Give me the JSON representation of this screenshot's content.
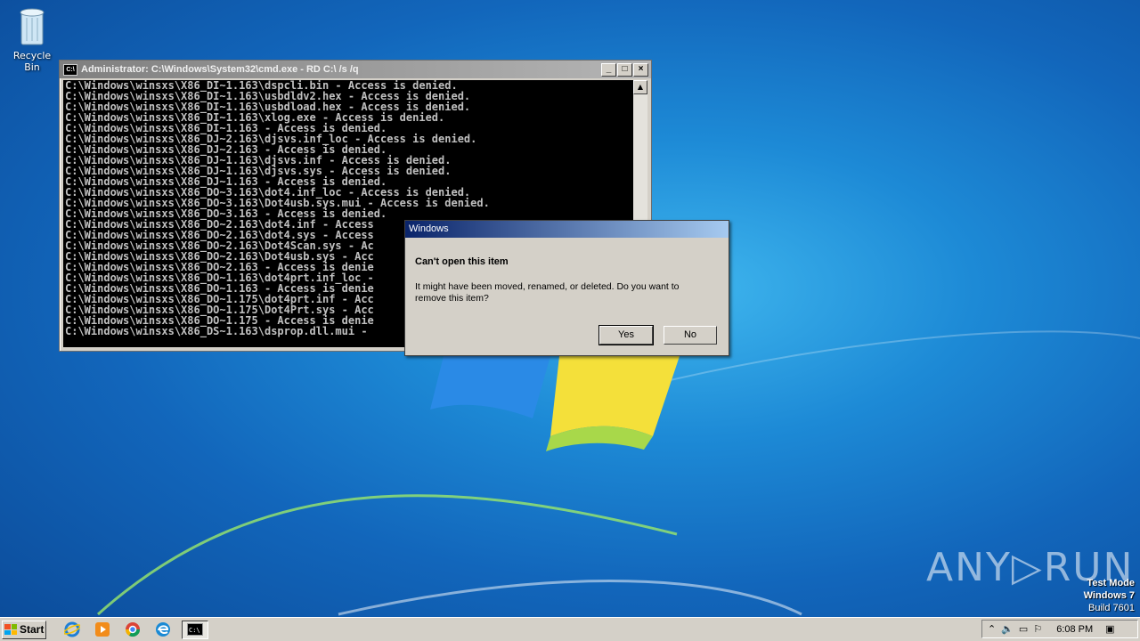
{
  "desktop": {
    "recycle_bin_label": "Recycle Bin"
  },
  "cmd_window": {
    "title": "Administrator: C:\\Windows\\System32\\cmd.exe - RD  C:\\ /s /q",
    "icon_label": "C:\\",
    "minimize": "_",
    "maximize": "□",
    "close": "×",
    "lines": [
      "C:\\Windows\\winsxs\\X86_DI~1.163\\dspcli.bin - Access is denied.",
      "C:\\Windows\\winsxs\\X86_DI~1.163\\usbdldv2.hex - Access is denied.",
      "C:\\Windows\\winsxs\\X86_DI~1.163\\usbdload.hex - Access is denied.",
      "C:\\Windows\\winsxs\\X86_DI~1.163\\xlog.exe - Access is denied.",
      "C:\\Windows\\winsxs\\X86_DI~1.163 - Access is denied.",
      "C:\\Windows\\winsxs\\X86_DJ~2.163\\djsvs.inf_loc - Access is denied.",
      "C:\\Windows\\winsxs\\X86_DJ~2.163 - Access is denied.",
      "C:\\Windows\\winsxs\\X86_DJ~1.163\\djsvs.inf - Access is denied.",
      "C:\\Windows\\winsxs\\X86_DJ~1.163\\djsvs.sys - Access is denied.",
      "C:\\Windows\\winsxs\\X86_DJ~1.163 - Access is denied.",
      "C:\\Windows\\winsxs\\X86_DO~3.163\\dot4.inf_loc - Access is denied.",
      "C:\\Windows\\winsxs\\X86_DO~3.163\\Dot4usb.sys.mui - Access is denied.",
      "C:\\Windows\\winsxs\\X86_DO~3.163 - Access is denied.",
      "C:\\Windows\\winsxs\\X86_DO~2.163\\dot4.inf - Access",
      "C:\\Windows\\winsxs\\X86_DO~2.163\\dot4.sys - Access",
      "C:\\Windows\\winsxs\\X86_DO~2.163\\Dot4Scan.sys - Ac",
      "C:\\Windows\\winsxs\\X86_DO~2.163\\Dot4usb.sys - Acc",
      "C:\\Windows\\winsxs\\X86_DO~2.163 - Access is denie",
      "C:\\Windows\\winsxs\\X86_DO~1.163\\dot4prt.inf_loc -",
      "C:\\Windows\\winsxs\\X86_DO~1.163 - Access is denie",
      "C:\\Windows\\winsxs\\X86_DO~1.175\\dot4prt.inf - Acc",
      "C:\\Windows\\winsxs\\X86_DO~1.175\\Dot4Prt.sys - Acc",
      "C:\\Windows\\winsxs\\X86_DO~1.175 - Access is denie",
      "C:\\Windows\\winsxs\\X86_DS~1.163\\dsprop.dll.mui -"
    ]
  },
  "dialog": {
    "title": "Windows",
    "heading": "Can't open this item",
    "message": "It might have been moved, renamed, or deleted. Do you want to remove this item?",
    "yes_label": "Yes",
    "no_label": "No"
  },
  "watermark": {
    "brand": "ANY▷RUN",
    "test_mode": "Test Mode",
    "os": "Windows 7",
    "build": "Build 7601"
  },
  "taskbar": {
    "start_label": "Start",
    "pinned": [
      "internet-explorer-icon",
      "media-player-icon",
      "chrome-icon",
      "edge-icon",
      "cmd-icon"
    ],
    "clock": "6:08 PM"
  }
}
